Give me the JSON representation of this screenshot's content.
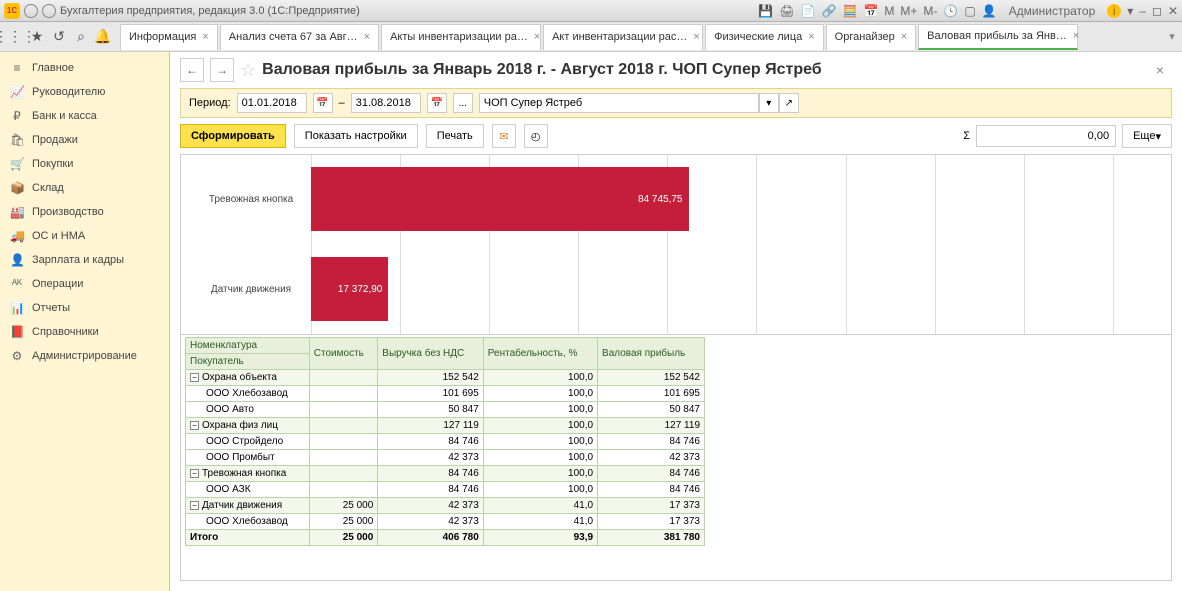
{
  "titlebar": {
    "app_label": "1С",
    "title": "Бухгалтерия предприятия, редакция 3.0  (1С:Предприятие)",
    "admin": "Администратор",
    "m1": "М",
    "m2": "М+",
    "m3": "М-"
  },
  "tabs": [
    {
      "label": "Информация",
      "active": false
    },
    {
      "label": "Анализ счета 67 за Авг…",
      "active": false
    },
    {
      "label": "Акты инвентаризации ра…",
      "active": false
    },
    {
      "label": "Акт инвентаризации рас…",
      "active": false
    },
    {
      "label": "Физические лица",
      "active": false
    },
    {
      "label": "Органайзер",
      "active": false
    },
    {
      "label": "Валовая прибыль за Янв…",
      "active": true
    }
  ],
  "sidebar": {
    "items": [
      {
        "icon": "≡",
        "label": "Главное"
      },
      {
        "icon": "📈",
        "label": "Руководителю"
      },
      {
        "icon": "₽",
        "label": "Банк и касса"
      },
      {
        "icon": "🛍",
        "label": "Продажи"
      },
      {
        "icon": "🛒",
        "label": "Покупки"
      },
      {
        "icon": "📦",
        "label": "Склад"
      },
      {
        "icon": "🏭",
        "label": "Производство"
      },
      {
        "icon": "🚚",
        "label": "ОС и НМА"
      },
      {
        "icon": "👤",
        "label": "Зарплата и кадры"
      },
      {
        "icon": "ᴬᴷ",
        "label": "Операции"
      },
      {
        "icon": "📊",
        "label": "Отчеты"
      },
      {
        "icon": "📕",
        "label": "Справочники"
      },
      {
        "icon": "⚙",
        "label": "Администрирование"
      }
    ]
  },
  "page": {
    "title": "Валовая прибыль за Январь 2018 г. - Август 2018 г. ЧОП Супер Ястреб",
    "period_label": "Период:",
    "date_from": "01.01.2018",
    "date_to": "31.08.2018",
    "dash": "–",
    "ellipsis": "...",
    "org": "ЧОП Супер Ястреб",
    "btn_form": "Сформировать",
    "btn_settings": "Показать настройки",
    "btn_print": "Печать",
    "sigma": "Σ",
    "sum_value": "0,00",
    "btn_more": "Еще"
  },
  "chart_data": {
    "type": "bar",
    "orientation": "horizontal",
    "categories": [
      "Тревожная кнопка",
      "Датчик движения"
    ],
    "values": [
      84745.75,
      17372.9
    ],
    "value_labels": [
      "84 745,75",
      "17 372,90"
    ],
    "xlim": [
      0,
      90000
    ],
    "gridlines": [
      0,
      20000,
      40000,
      60000,
      80000,
      100000,
      120000,
      140000,
      160000,
      180000,
      200000,
      220000
    ],
    "bar_color": "#c41e3a"
  },
  "table": {
    "headers": {
      "c1a": "Номенклатура",
      "c1b": "Покупатель",
      "c2": "Стоимость",
      "c3": "Выручка без НДС",
      "c4": "Рентабельность, %",
      "c5": "Валовая прибыль"
    },
    "rows": [
      {
        "type": "grp",
        "label": "Охрана объекта",
        "cost": "",
        "rev": "152 542",
        "rent": "100,0",
        "prof": "152 542"
      },
      {
        "type": "sub",
        "label": "ООО Хлебозавод",
        "cost": "",
        "rev": "101 695",
        "rent": "100,0",
        "prof": "101 695"
      },
      {
        "type": "sub",
        "label": "ООО Авто",
        "cost": "",
        "rev": "50 847",
        "rent": "100,0",
        "prof": "50 847"
      },
      {
        "type": "grp",
        "label": "Охрана физ лиц",
        "cost": "",
        "rev": "127 119",
        "rent": "100,0",
        "prof": "127 119"
      },
      {
        "type": "sub",
        "label": "ООО Стройдело",
        "cost": "",
        "rev": "84 746",
        "rent": "100,0",
        "prof": "84 746"
      },
      {
        "type": "sub",
        "label": "ООО Промбыт",
        "cost": "",
        "rev": "42 373",
        "rent": "100,0",
        "prof": "42 373"
      },
      {
        "type": "grp",
        "label": "Тревожная кнопка",
        "cost": "",
        "rev": "84 746",
        "rent": "100,0",
        "prof": "84 746"
      },
      {
        "type": "sub",
        "label": "ООО АЗК",
        "cost": "",
        "rev": "84 746",
        "rent": "100,0",
        "prof": "84 746"
      },
      {
        "type": "grp",
        "label": "Датчик движения",
        "cost": "25 000",
        "rev": "42 373",
        "rent": "41,0",
        "prof": "17 373"
      },
      {
        "type": "sub",
        "label": "ООО Хлебозавод",
        "cost": "25 000",
        "rev": "42 373",
        "rent": "41,0",
        "prof": "17 373"
      },
      {
        "type": "tot",
        "label": "Итого",
        "cost": "25 000",
        "rev": "406 780",
        "rent": "93,9",
        "prof": "381 780"
      }
    ]
  }
}
